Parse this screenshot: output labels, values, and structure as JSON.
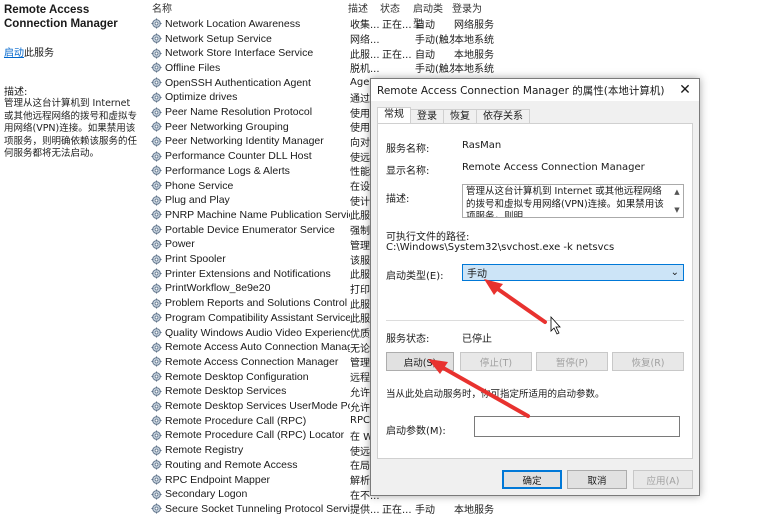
{
  "left_pane": {
    "service_title": "Remote Access Connection Manager",
    "start_link": "启动",
    "start_suffix": "此服务",
    "desc_label": "描述:",
    "desc_text": "管理从这台计算机到 Internet 或其他远程网络的拨号和虚拟专用网络(VPN)连接。如果禁用该项服务，则明确依赖该服务的任何服务都将无法启动。"
  },
  "list": {
    "headers": {
      "name": "名称",
      "desc": "描述",
      "status": "状态",
      "startup": "启动类型",
      "logon": "登录为"
    },
    "rows": [
      {
        "name": "Network Location Awareness",
        "desc": "收集...",
        "status": "正在...",
        "startup": "自动",
        "logon": "网络服务"
      },
      {
        "name": "Network Setup Service",
        "desc": "网络...",
        "status": "",
        "startup": "手动(触发...",
        "logon": "本地系统"
      },
      {
        "name": "Network Store Interface Service",
        "desc": "此服...",
        "status": "正在...",
        "startup": "自动",
        "logon": "本地服务"
      },
      {
        "name": "Offline Files",
        "desc": "脱机...",
        "status": "",
        "startup": "手动(触发...",
        "logon": "本地系统"
      },
      {
        "name": "OpenSSH Authentication Agent",
        "desc": "Agen...",
        "status": "",
        "startup": "",
        "logon": ""
      },
      {
        "name": "Optimize drives",
        "desc": "通过...",
        "status": "",
        "startup": "",
        "logon": ""
      },
      {
        "name": "Peer Name Resolution Protocol",
        "desc": "使用...",
        "status": "",
        "startup": "",
        "logon": ""
      },
      {
        "name": "Peer Networking Grouping",
        "desc": "使用...",
        "status": "",
        "startup": "",
        "logon": ""
      },
      {
        "name": "Peer Networking Identity Manager",
        "desc": "向对...",
        "status": "",
        "startup": "",
        "logon": ""
      },
      {
        "name": "Performance Counter DLL Host",
        "desc": "使远...",
        "status": "",
        "startup": "",
        "logon": ""
      },
      {
        "name": "Performance Logs & Alerts",
        "desc": "性能...",
        "status": "",
        "startup": "",
        "logon": ""
      },
      {
        "name": "Phone Service",
        "desc": "在设...",
        "status": "",
        "startup": "",
        "logon": ""
      },
      {
        "name": "Plug and Play",
        "desc": "使计...",
        "status": "",
        "startup": "",
        "logon": ""
      },
      {
        "name": "PNRP Machine Name Publication Service",
        "desc": "此服...",
        "status": "",
        "startup": "",
        "logon": ""
      },
      {
        "name": "Portable Device Enumerator Service",
        "desc": "强制...",
        "status": "",
        "startup": "",
        "logon": ""
      },
      {
        "name": "Power",
        "desc": "管理...",
        "status": "",
        "startup": "",
        "logon": ""
      },
      {
        "name": "Print Spooler",
        "desc": "该服...",
        "status": "",
        "startup": "",
        "logon": ""
      },
      {
        "name": "Printer Extensions and Notifications",
        "desc": "此服...",
        "status": "",
        "startup": "",
        "logon": ""
      },
      {
        "name": "PrintWorkflow_8e9e20",
        "desc": "打印...",
        "status": "",
        "startup": "",
        "logon": ""
      },
      {
        "name": "Problem Reports and Solutions Control Pa...",
        "desc": "此服...",
        "status": "",
        "startup": "",
        "logon": ""
      },
      {
        "name": "Program Compatibility Assistant Service",
        "desc": "此服...",
        "status": "",
        "startup": "",
        "logon": ""
      },
      {
        "name": "Quality Windows Audio Video Experience",
        "desc": "优质...",
        "status": "",
        "startup": "",
        "logon": ""
      },
      {
        "name": "Remote Access Auto Connection Manager",
        "desc": "无论...",
        "status": "",
        "startup": "",
        "logon": ""
      },
      {
        "name": "Remote Access Connection Manager",
        "desc": "管理...",
        "status": "",
        "startup": "",
        "logon": ""
      },
      {
        "name": "Remote Desktop Configuration",
        "desc": "远程...",
        "status": "",
        "startup": "",
        "logon": ""
      },
      {
        "name": "Remote Desktop Services",
        "desc": "允许...",
        "status": "",
        "startup": "",
        "logon": ""
      },
      {
        "name": "Remote Desktop Services UserMode Port ...",
        "desc": "允许...",
        "status": "",
        "startup": "",
        "logon": ""
      },
      {
        "name": "Remote Procedure Call (RPC)",
        "desc": "RPC...",
        "status": "",
        "startup": "",
        "logon": ""
      },
      {
        "name": "Remote Procedure Call (RPC) Locator",
        "desc": "在 W...",
        "status": "",
        "startup": "",
        "logon": ""
      },
      {
        "name": "Remote Registry",
        "desc": "使远...",
        "status": "",
        "startup": "",
        "logon": ""
      },
      {
        "name": "Routing and Remote Access",
        "desc": "在局...",
        "status": "",
        "startup": "",
        "logon": ""
      },
      {
        "name": "RPC Endpoint Mapper",
        "desc": "解析...",
        "status": "",
        "startup": "",
        "logon": ""
      },
      {
        "name": "Secondary Logon",
        "desc": "在不...",
        "status": "",
        "startup": "",
        "logon": ""
      },
      {
        "name": "Secure Socket Tunneling Protocol Service",
        "desc": "提供...",
        "status": "正在...",
        "startup": "手动",
        "logon": "本地服务"
      }
    ]
  },
  "dialog": {
    "title": "Remote Access Connection Manager 的属性(本地计算机)",
    "close_glyph": "✕",
    "tabs": [
      "常规",
      "登录",
      "恢复",
      "依存关系"
    ],
    "service_name_label": "服务名称:",
    "service_name": "RasMan",
    "display_name_label": "显示名称:",
    "display_name": "Remote Access Connection Manager",
    "desc_label": "描述:",
    "desc_text": "管理从这台计算机到 Internet 或其他远程网络的拨号和虚拟专用网络(VPN)连接。如果禁用该项服务，则明",
    "exe_path_label": "可执行文件的路径:",
    "exe_path": "C:\\Windows\\System32\\svchost.exe -k netsvcs",
    "startup_type_label": "启动类型(E):",
    "startup_type": "手动",
    "status_label": "服务状态:",
    "status": "已停止",
    "buttons": {
      "start": "启动(S)",
      "stop": "停止(T)",
      "pause": "暂停(P)",
      "resume": "恢复(R)"
    },
    "note": "当从此处启动服务时，你可指定所适用的启动参数。",
    "param_label": "启动参数(M):",
    "footer": {
      "ok": "确定",
      "cancel": "取消",
      "apply": "应用(A)"
    }
  },
  "colors": {
    "annotation_arrow": "#e8322f",
    "accent": "#0078d7",
    "combo_bg": "#cce4f7"
  }
}
